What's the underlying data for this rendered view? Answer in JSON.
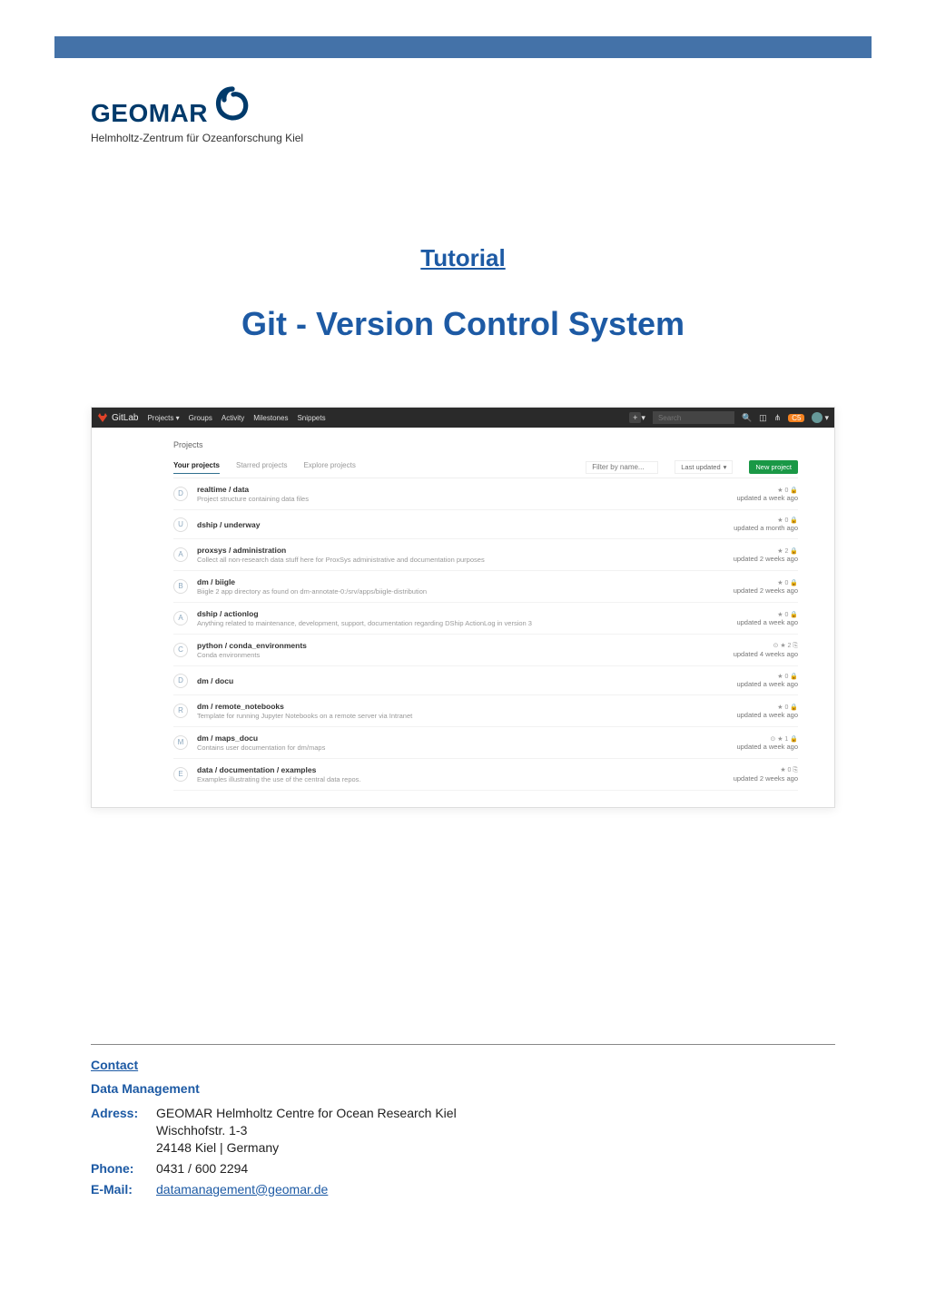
{
  "logo": {
    "name": "GEOMAR",
    "subtitle": "Helmholtz-Zentrum für Ozeanforschung Kiel"
  },
  "headings": {
    "tutorial": "Tutorial",
    "git_title": "Git - Version Control System"
  },
  "gitlab": {
    "brand": "GitLab",
    "nav": {
      "projects": "Projects",
      "groups": "Groups",
      "activity": "Activity",
      "milestones": "Milestones",
      "snippets": "Snippets"
    },
    "plus_badge": "+",
    "search_placeholder": "Search",
    "header_badge": "C5",
    "page_heading": "Projects",
    "tabs": {
      "your": "Your projects",
      "starred": "Starred projects",
      "explore": "Explore projects"
    },
    "filter_placeholder": "Filter by name...",
    "sort_label": "Last updated",
    "new_project": "New project",
    "rows": [
      {
        "letter": "D",
        "title": "realtime / data",
        "desc": "Project structure containing data files",
        "icons": "★ 0  🔒",
        "updated": "updated a week ago"
      },
      {
        "letter": "U",
        "title": "dship / underway",
        "desc": "",
        "icons": "★ 0  🔒",
        "updated": "updated a month ago"
      },
      {
        "letter": "A",
        "title": "proxsys / administration",
        "desc": "Collect all non-research data stuff here for ProxSys administrative and documentation purposes",
        "icons": "★ 2  🔒",
        "updated": "updated 2 weeks ago"
      },
      {
        "letter": "B",
        "title": "dm / biigle",
        "desc": "Biigle 2 app directory as found on dm-annotate-0:/srv/apps/biigle-distribution",
        "icons": "★ 0  🔒",
        "updated": "updated 2 weeks ago"
      },
      {
        "letter": "A",
        "title": "dship / actionlog",
        "desc": "Anything related to maintenance, development, support, documentation regarding DShip ActionLog in version 3",
        "icons": "★ 0  🔒",
        "updated": "updated a week ago"
      },
      {
        "letter": "C",
        "title": "python / conda_environments",
        "desc": "Conda environments",
        "icons": "⊙  ★ 2  ⎘",
        "updated": "updated 4 weeks ago"
      },
      {
        "letter": "D",
        "title": "dm / docu",
        "desc": "",
        "icons": "★ 0  🔒",
        "updated": "updated a week ago"
      },
      {
        "letter": "R",
        "title": "dm / remote_notebooks",
        "desc": "Template for running Jupyter Notebooks on a remote server via Intranet",
        "icons": "★ 0  🔒",
        "updated": "updated a week ago"
      },
      {
        "letter": "M",
        "title": "dm / maps_docu",
        "desc": "Contains user documentation for dm/maps",
        "icons": "⊙  ★ 1  🔒",
        "updated": "updated a week ago"
      },
      {
        "letter": "E",
        "title": "data / documentation / examples",
        "desc": "Examples illustrating the use of the central data repos.",
        "icons": "★ 0  ⎘",
        "updated": "updated 2 weeks ago"
      }
    ]
  },
  "contact": {
    "heading": "Contact",
    "sub": "Data Management",
    "address_label": "Adress:",
    "address_line1": "GEOMAR Helmholtz Centre for Ocean Research Kiel",
    "address_line2": "Wischhofstr. 1-3",
    "address_line3": "24148 Kiel | Germany",
    "phone_label": "Phone:",
    "phone": "0431 / 600 2294",
    "email_label": "E-Mail:",
    "email": "datamanagement@geomar.de"
  }
}
